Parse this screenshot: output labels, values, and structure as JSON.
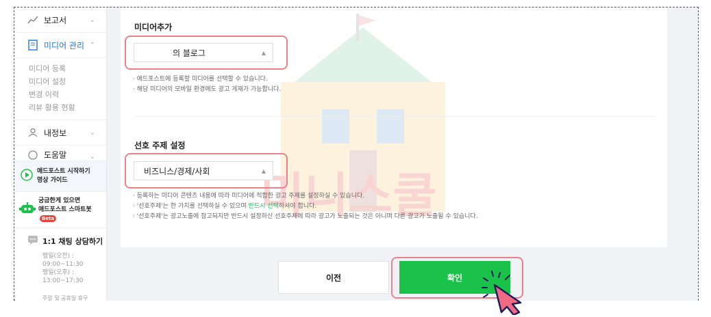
{
  "sidebar": {
    "report_label": "보고서",
    "media_label": "미디어 관리",
    "media_items": [
      "미디어 등록",
      "미디어 설정",
      "변경 이력",
      "리뷰 활용 현황"
    ],
    "myinfo_label": "내정보",
    "help_label": "도움말",
    "guide_line1": "애드포스트 시작하기",
    "guide_line2": "영상 가이드",
    "bot_line1": "궁금한게 있으면",
    "bot_line2": "애드포스트 스마트봇",
    "bot_badge": "Beta",
    "chat_title": "1:1 채팅 상담하기",
    "chat_hours": [
      "평일(오전) :",
      "09:00~11:30",
      "평일(오후) :",
      "13:00~17:30"
    ],
    "chat_note": "주말 및 공휴일 휴무"
  },
  "form": {
    "media_add_label": "미디어추가",
    "media_select_value": "의 블로그",
    "media_help_1": "· 애드포스트에 등록할 미디어를 선택할 수 있습니다.",
    "media_help_2": "· 해당 미디어의 모바일 환경에도 광고 게재가 가능합니다.",
    "topic_label": "선호 주제 설정",
    "topic_select_value": "비즈니스/경제/사회",
    "topic_help_1": "· 등록하는 미디어 콘텐츠 내용에 따라 미디어에 적합한 광고 주제를 설정하실 수 있습니다.",
    "topic_help_2_pre": "· '선호주제'는 한 가지를 선택하실 수 있으며 ",
    "topic_help_2_green": "반드시 선택",
    "topic_help_2_post": "하셔야 합니다.",
    "topic_help_3": "· '선호주제'는 광고노출에 참고되지만 반드시 설정하신 선호주제에 따라 광고가 노출되는 것은 아니며 다른 광고가 노출될 수 있습니다."
  },
  "buttons": {
    "prev_label": "이전",
    "ok_label": "확인"
  },
  "colors": {
    "accent_green": "#1bc24a",
    "highlight": "#e88189",
    "active_blue": "#1a73e8"
  }
}
